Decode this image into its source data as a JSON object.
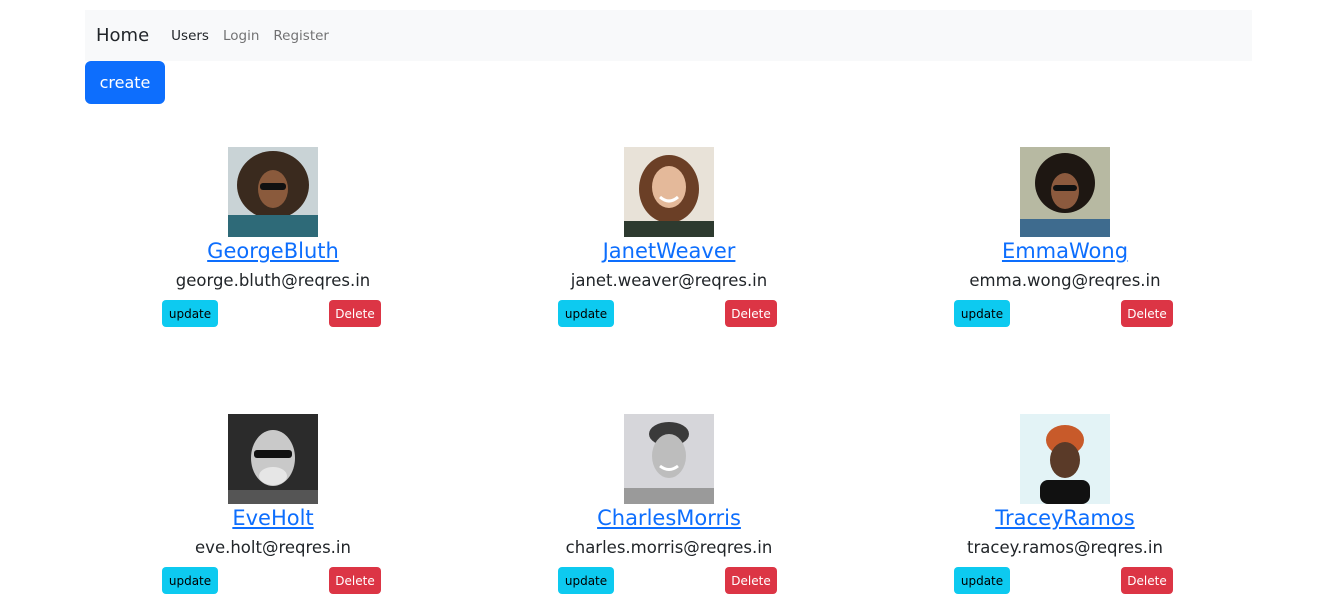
{
  "navbar": {
    "brand": "Home",
    "links": [
      "Users",
      "Login",
      "Register"
    ]
  },
  "create_label": "create",
  "users": [
    {
      "name": "GeorgeBluth",
      "email": "george.bluth@reqres.in",
      "update_label": "update",
      "delete_label": "Delete"
    },
    {
      "name": "JanetWeaver",
      "email": "janet.weaver@reqres.in",
      "update_label": "update",
      "delete_label": "Delete"
    },
    {
      "name": "EmmaWong",
      "email": "emma.wong@reqres.in",
      "update_label": "update",
      "delete_label": "Delete"
    },
    {
      "name": "EveHolt",
      "email": "eve.holt@reqres.in",
      "update_label": "update",
      "delete_label": "Delete"
    },
    {
      "name": "CharlesMorris",
      "email": "charles.morris@reqres.in",
      "update_label": "update",
      "delete_label": "Delete"
    },
    {
      "name": "TraceyRamos",
      "email": "tracey.ramos@reqres.in",
      "update_label": "update",
      "delete_label": "Delete"
    }
  ],
  "colors": {
    "primary": "#0d6efd",
    "info": "#0dcaf0",
    "danger": "#dc3545",
    "navbar_bg": "#f8f9fa"
  }
}
